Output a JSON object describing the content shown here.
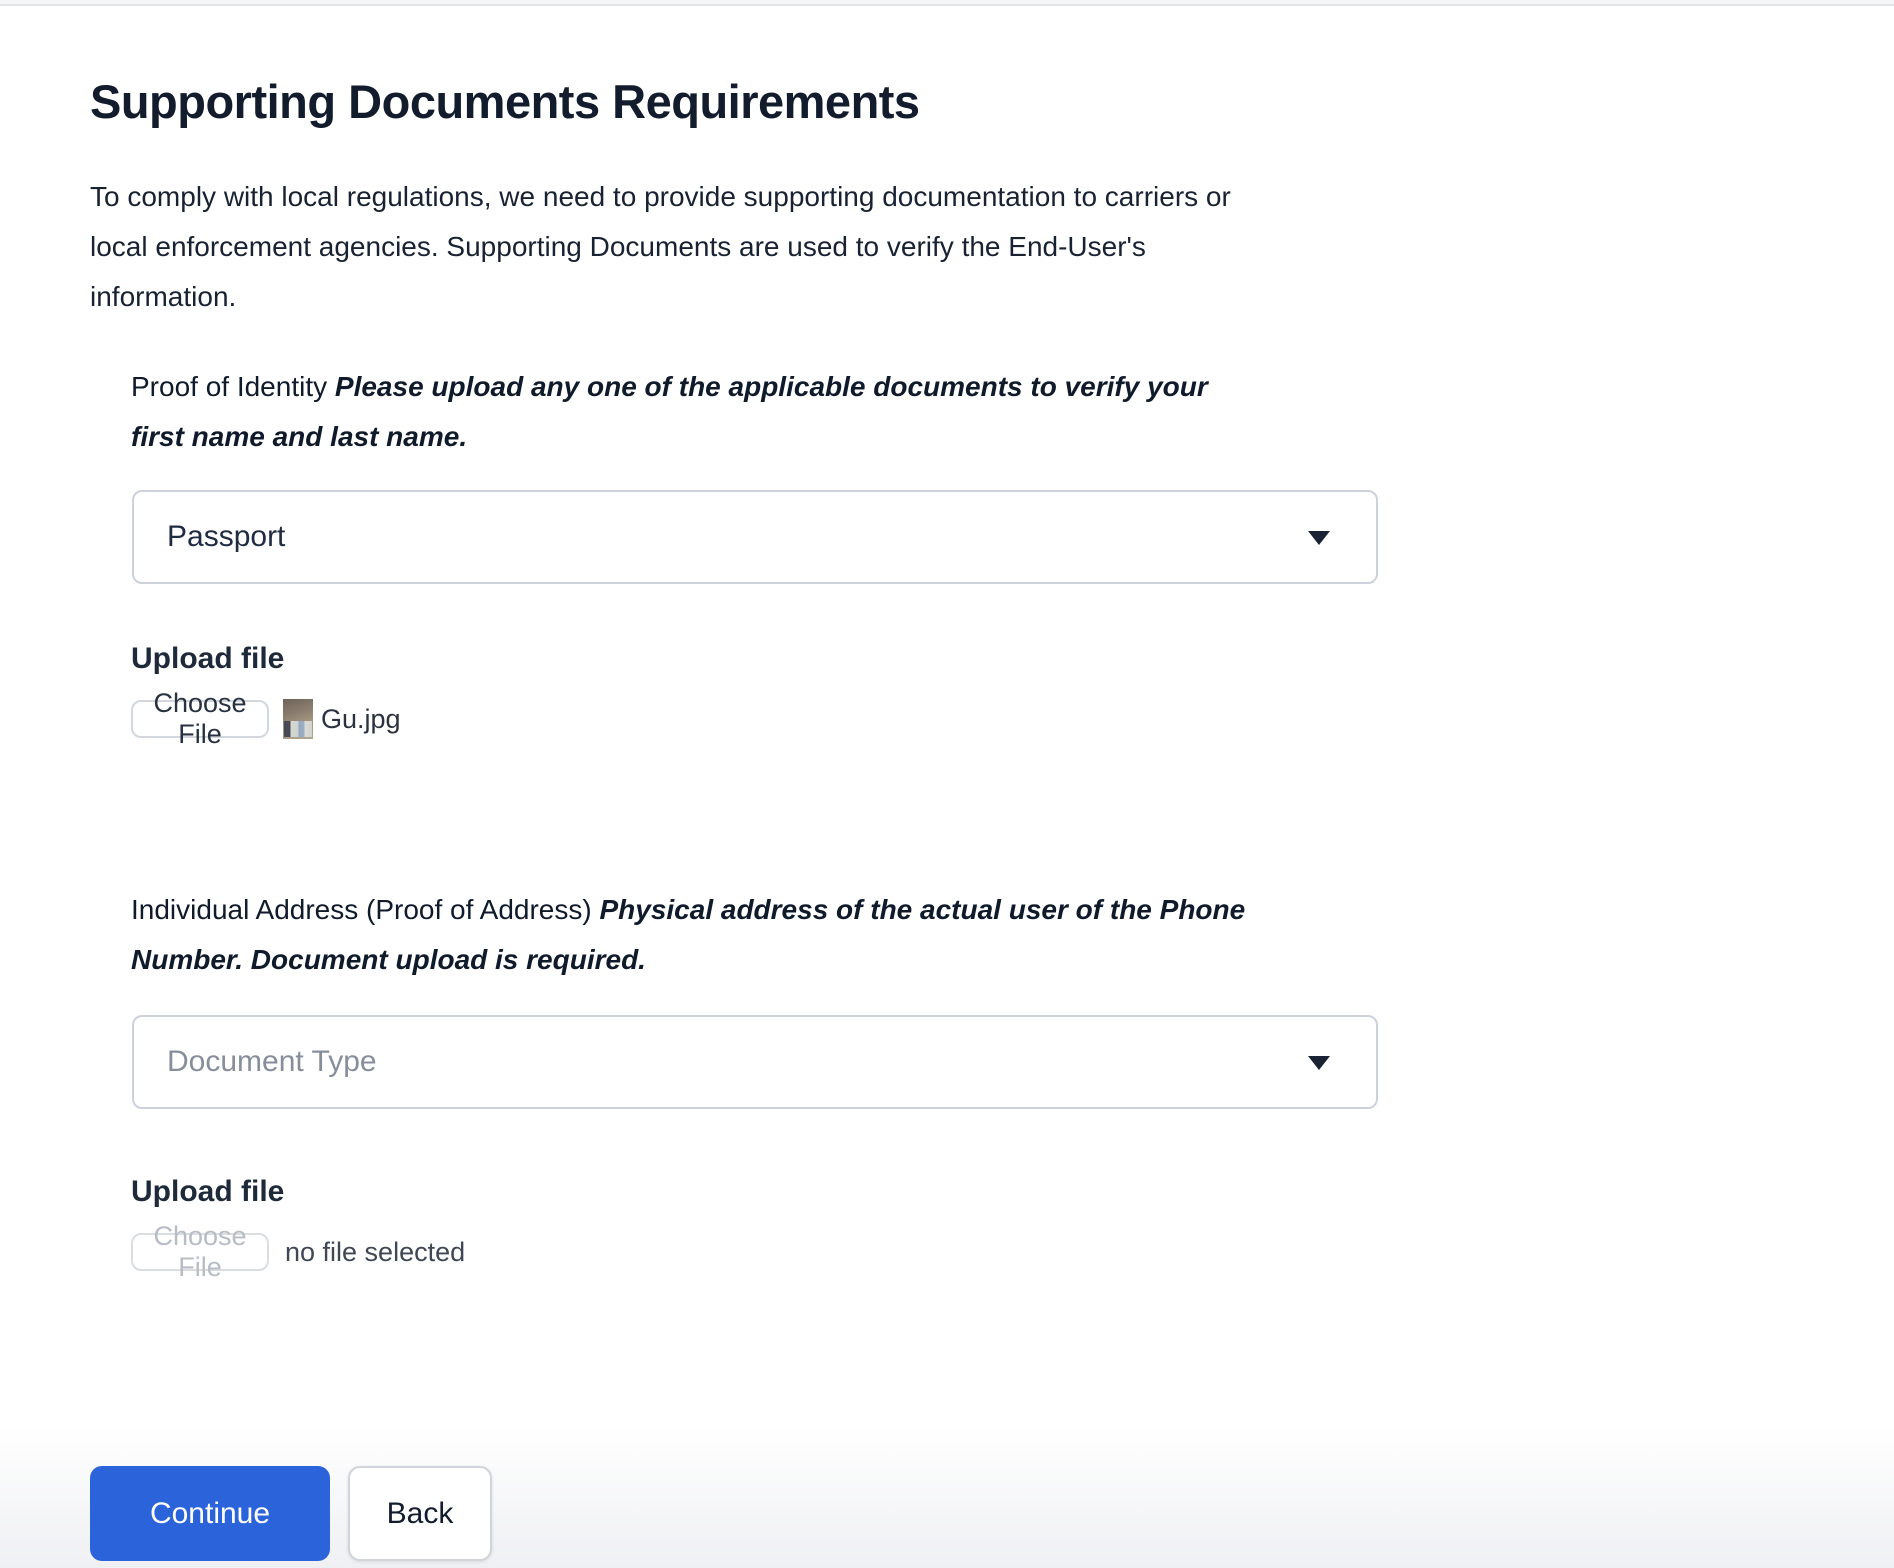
{
  "page": {
    "title": "Supporting Documents Requirements",
    "description_lines": [
      "To comply with local regulations, we need to provide supporting documentation to carriers or",
      "local enforcement agencies. Supporting Documents are used to verify the End-User's",
      "information."
    ]
  },
  "identity_section": {
    "label_prefix": "Proof of Identity ",
    "label_emphasis_line1": "Please upload any one of the applicable documents to verify your",
    "label_emphasis_line2": "first name and last name.",
    "document_type_value": "Passport",
    "upload_label": "Upload file",
    "choose_file_label": "Choose File",
    "file_name": "Gu.jpg"
  },
  "address_section": {
    "label_prefix": "Individual Address (Proof of Address) ",
    "label_emphasis_line1": "Physical address of the actual user of the Phone",
    "label_emphasis_line2": "Number. Document upload is required.",
    "document_type_placeholder": "Document Type",
    "upload_label": "Upload file",
    "choose_file_label": "Choose File",
    "file_status": "no file selected"
  },
  "actions": {
    "continue_label": "Continue",
    "back_label": "Back"
  },
  "colors": {
    "primary_blue": "#2b63da",
    "text_dark": "#121c2d",
    "placeholder_gray": "#878e9b",
    "border_gray": "#ccd1db",
    "top_strip_gray": "#f4f5f7"
  }
}
